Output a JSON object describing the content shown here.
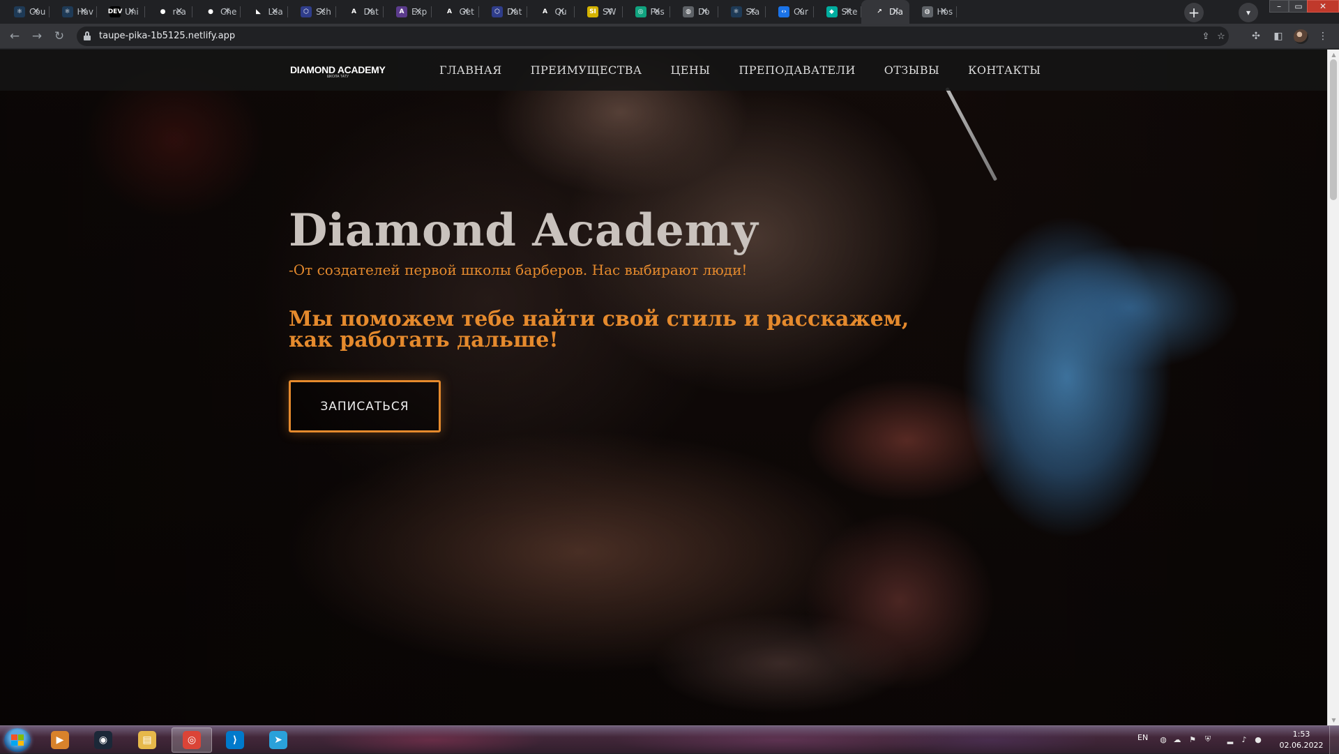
{
  "browser": {
    "tabs": [
      {
        "title": "Cou",
        "icon": "react-icon",
        "fav": "⚛",
        "color": "#1e3a56"
      },
      {
        "title": "Hav",
        "icon": "react-icon",
        "fav": "⚛",
        "color": "#1e3a56"
      },
      {
        "title": "Uni",
        "icon": "dev-icon",
        "fav": "DEV",
        "color": "#000000"
      },
      {
        "title": "rea",
        "icon": "github-icon",
        "fav": "●",
        "color": "#202124"
      },
      {
        "title": "Che",
        "icon": "github-icon",
        "fav": "●",
        "color": "#202124"
      },
      {
        "title": "Lea",
        "icon": "leaf-icon",
        "fav": "◣",
        "color": "#202124"
      },
      {
        "title": "Sch",
        "icon": "hexagon-icon",
        "fav": "⬡",
        "color": "#2f3d8a"
      },
      {
        "title": "Dat",
        "icon": "apollo-icon",
        "fav": "A",
        "color": "#202124"
      },
      {
        "title": "Exp",
        "icon": "apollo-explorer-icon",
        "fav": "A",
        "color": "#5b3b8c"
      },
      {
        "title": "Get",
        "icon": "apollo-icon",
        "fav": "A",
        "color": "#202124"
      },
      {
        "title": "Dat",
        "icon": "hexagon-icon",
        "fav": "⬡",
        "color": "#2f3d8a"
      },
      {
        "title": "Qu",
        "icon": "apollo-icon",
        "fav": "A",
        "color": "#202124"
      },
      {
        "title": "SW",
        "icon": "swr-icon",
        "fav": "SI",
        "color": "#d4b300"
      },
      {
        "title": "Pas",
        "icon": "chatgpt-icon",
        "fav": "◎",
        "color": "#10a37f"
      },
      {
        "title": "Do",
        "icon": "globe-icon",
        "fav": "◍",
        "color": "#5f6368"
      },
      {
        "title": "Sta",
        "icon": "react-icon",
        "fav": "⚛",
        "color": "#1e3a56"
      },
      {
        "title": "Cur",
        "icon": "code-icon",
        "fav": "‹›",
        "color": "#1a73e8"
      },
      {
        "title": "Site",
        "icon": "netlify-icon",
        "fav": "◆",
        "color": "#00ad9f"
      },
      {
        "title": "Dia",
        "icon": "tattoo-machine-icon",
        "fav": "↗",
        "color": "#35363a",
        "active": true
      },
      {
        "title": "Hos",
        "icon": "globe-icon",
        "fav": "◍",
        "color": "#5f6368"
      }
    ],
    "url": "taupe-pika-1b5125.netlify.app"
  },
  "site": {
    "logo": "DIAMOND ACADEMY",
    "logo_sub": "ШКОЛА ТАТУ",
    "nav": [
      "ГЛАВНАЯ",
      "ПРЕИМУЩЕСТВА",
      "ЦЕНЫ",
      "ПРЕПОДАВАТЕЛИ",
      "ОТЗЫВЫ",
      "КОНТАКТЫ"
    ],
    "hero_title": "Diamond Academy",
    "hero_subtitle": "-От создателей первой школы барберов. Нас выбирают люди!",
    "hero_tagline": "Мы поможем тебе найти свой стиль и расскажем, как работать дальше!",
    "cta_label": "ЗАПИСАТЬСЯ",
    "accent_color": "#e58a2d"
  },
  "taskbar": {
    "apps": [
      {
        "name": "media-player-icon",
        "glyph": "▶",
        "color": "#d9822b"
      },
      {
        "name": "steam-icon",
        "glyph": "◉",
        "color": "#1b2838"
      },
      {
        "name": "file-explorer-icon",
        "glyph": "▤",
        "color": "#e6b84a"
      },
      {
        "name": "chrome-icon",
        "glyph": "◎",
        "color": "#db4437",
        "active": true
      },
      {
        "name": "vscode-icon",
        "glyph": "⟩",
        "color": "#007acc"
      },
      {
        "name": "telegram-icon",
        "glyph": "➤",
        "color": "#2aa1da"
      }
    ],
    "language": "EN",
    "time": "1:53",
    "date": "02.06.2022"
  }
}
